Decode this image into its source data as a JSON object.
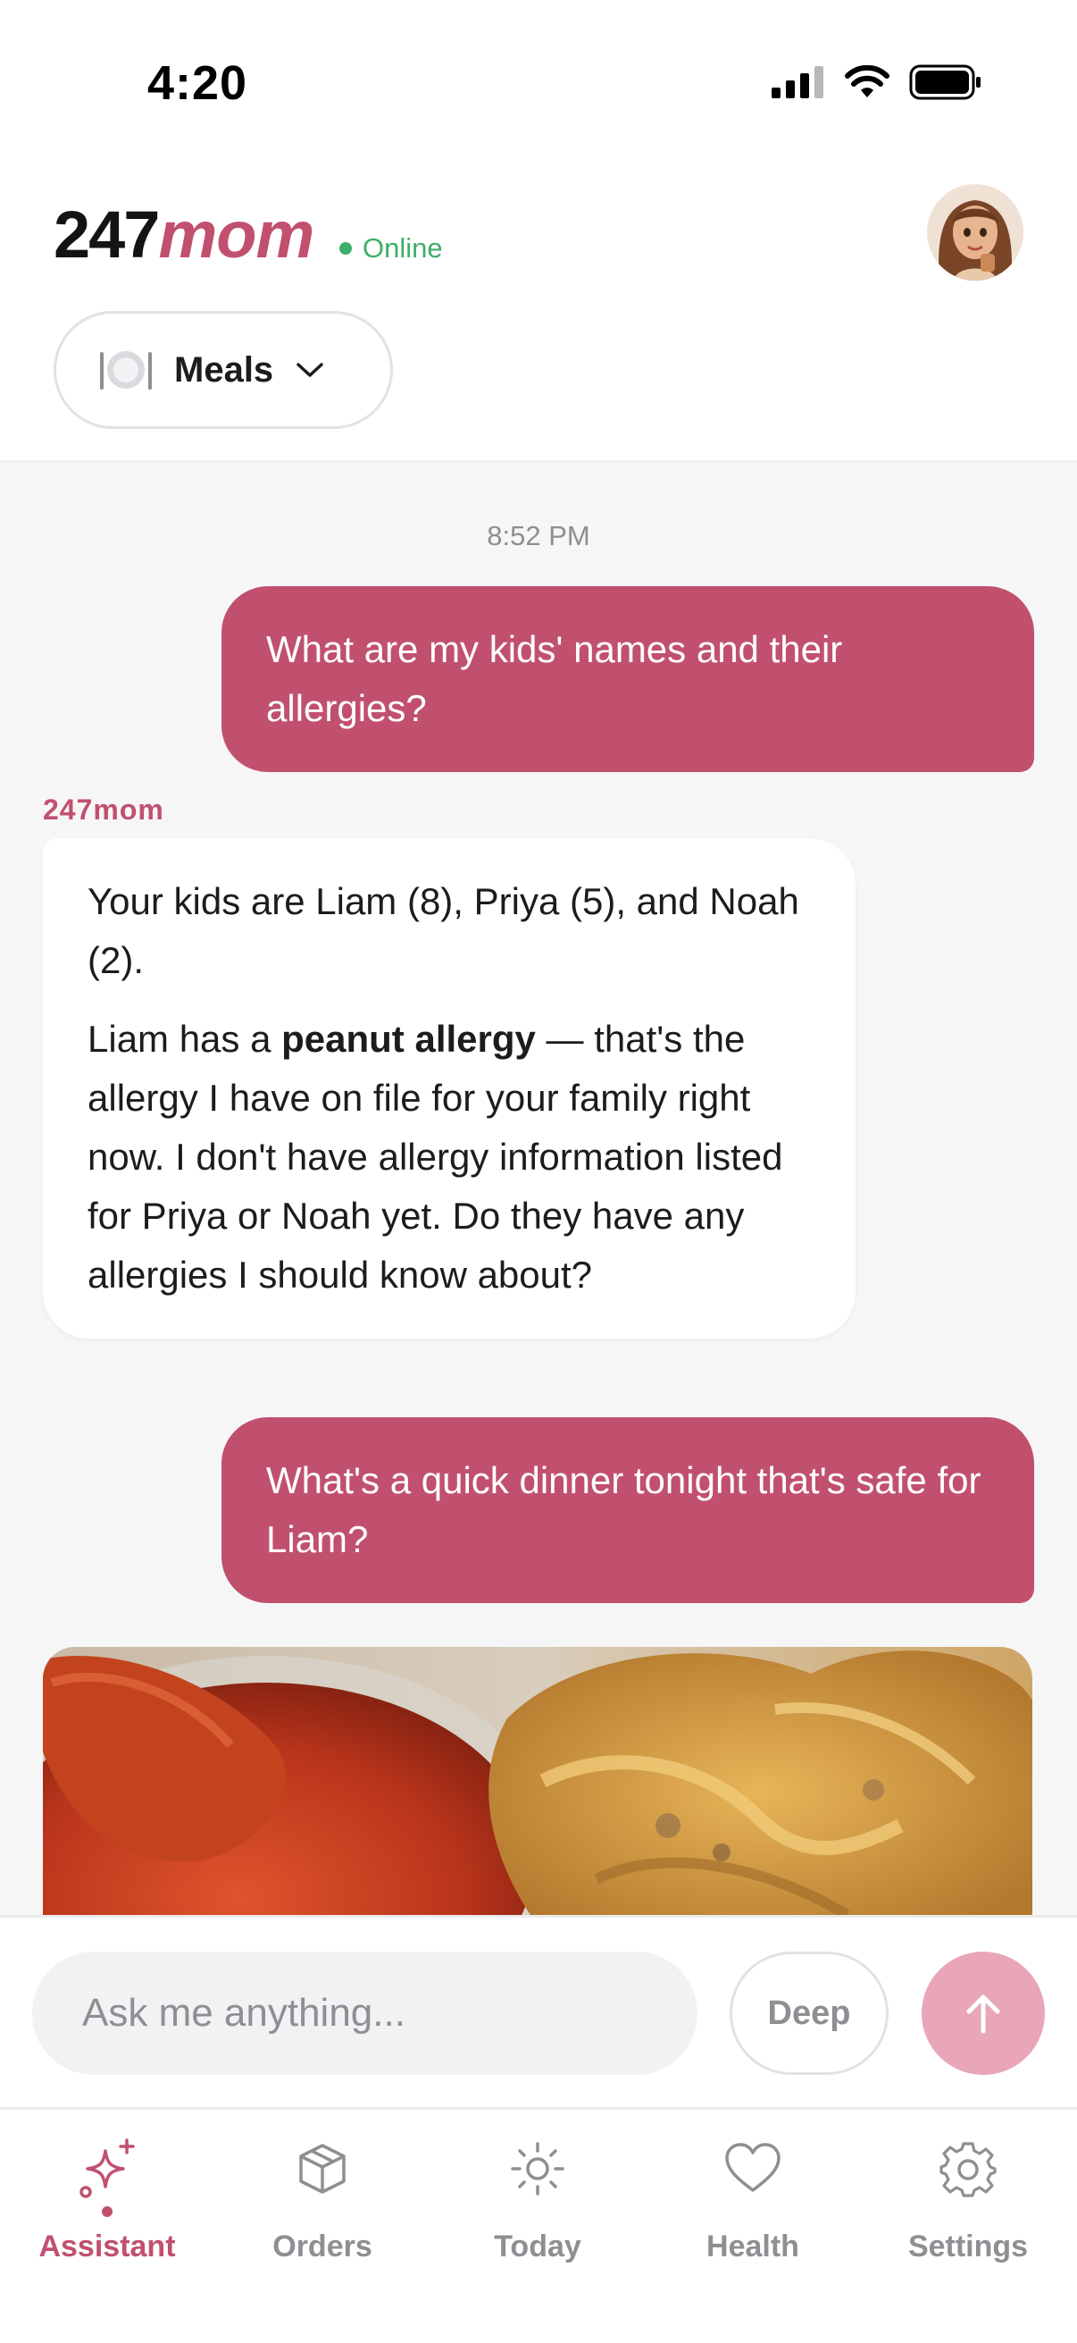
{
  "status_bar": {
    "time": "4:20",
    "icons": [
      "cellular-signal-icon",
      "wifi-icon",
      "battery-icon"
    ]
  },
  "header": {
    "brand_number": "247",
    "brand_word": "mom",
    "status": "Online",
    "category_icon": "plate-icon",
    "category_label": "Meals"
  },
  "chat": {
    "timestamp": "8:52 PM",
    "messages": [
      {
        "role": "user",
        "text": "What are my kids' names and their allergies?"
      },
      {
        "role": "assistant",
        "sender": "247mom",
        "paragraph1": "Your kids are Liam (8), Priya (5), and Noah (2).",
        "paragraph2_start": "Liam has a ",
        "paragraph2_bold": "peanut allergy",
        "paragraph2_end": " — that's the allergy I have on file for your family right now. I don't have allergy information listed for Priya or Noah yet. Do they have any allergies I should know about?"
      },
      {
        "role": "user",
        "text": "What's a quick dinner tonight that's safe for Liam?"
      }
    ],
    "media_card": "food-photo"
  },
  "composer": {
    "placeholder": "Ask me anything...",
    "deep_label": "Deep",
    "send_icon": "arrow-up-icon"
  },
  "tabs": [
    {
      "label": "Assistant",
      "icon": "sparkle-icon",
      "active": true
    },
    {
      "label": "Orders",
      "icon": "box-icon",
      "active": false
    },
    {
      "label": "Today",
      "icon": "sun-icon",
      "active": false
    },
    {
      "label": "Health",
      "icon": "heart-icon",
      "active": false
    },
    {
      "label": "Settings",
      "icon": "gear-icon",
      "active": false
    }
  ],
  "colors": {
    "brand": "#c1506f",
    "send_button": "#e8a6b8",
    "online": "#3fae6a",
    "chat_background": "#f6f6f7"
  }
}
